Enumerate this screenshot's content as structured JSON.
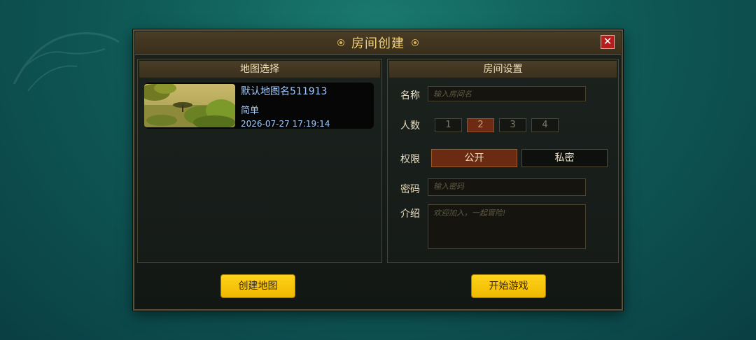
{
  "dialog": {
    "title": "房间创建",
    "close_label": "✕"
  },
  "map_panel": {
    "header": "地图选择",
    "maps": [
      {
        "name": "默认地图名511913",
        "difficulty": "简单",
        "date": "2026-07-27 17:19:14"
      }
    ]
  },
  "settings_panel": {
    "header": "房间设置",
    "name_label": "名称",
    "name_placeholder": "输入房间名",
    "players_label": "人数",
    "player_options": [
      "1",
      "2",
      "3",
      "4"
    ],
    "selected_players": "2",
    "permission_label": "权限",
    "permission_public": "公开",
    "permission_private": "私密",
    "selected_permission": "公开",
    "password_label": "密码",
    "password_placeholder": "输入密码",
    "intro_label": "介绍",
    "intro_placeholder": "欢迎加入，一起冒险!"
  },
  "buttons": {
    "create_map": "创建地图",
    "start_game": "开始游戏"
  },
  "colors": {
    "accent_yellow": "#f5c400",
    "active_red": "#6b2b12",
    "title_gold": "#f2d27a",
    "map_text_blue": "#9fcaff"
  }
}
